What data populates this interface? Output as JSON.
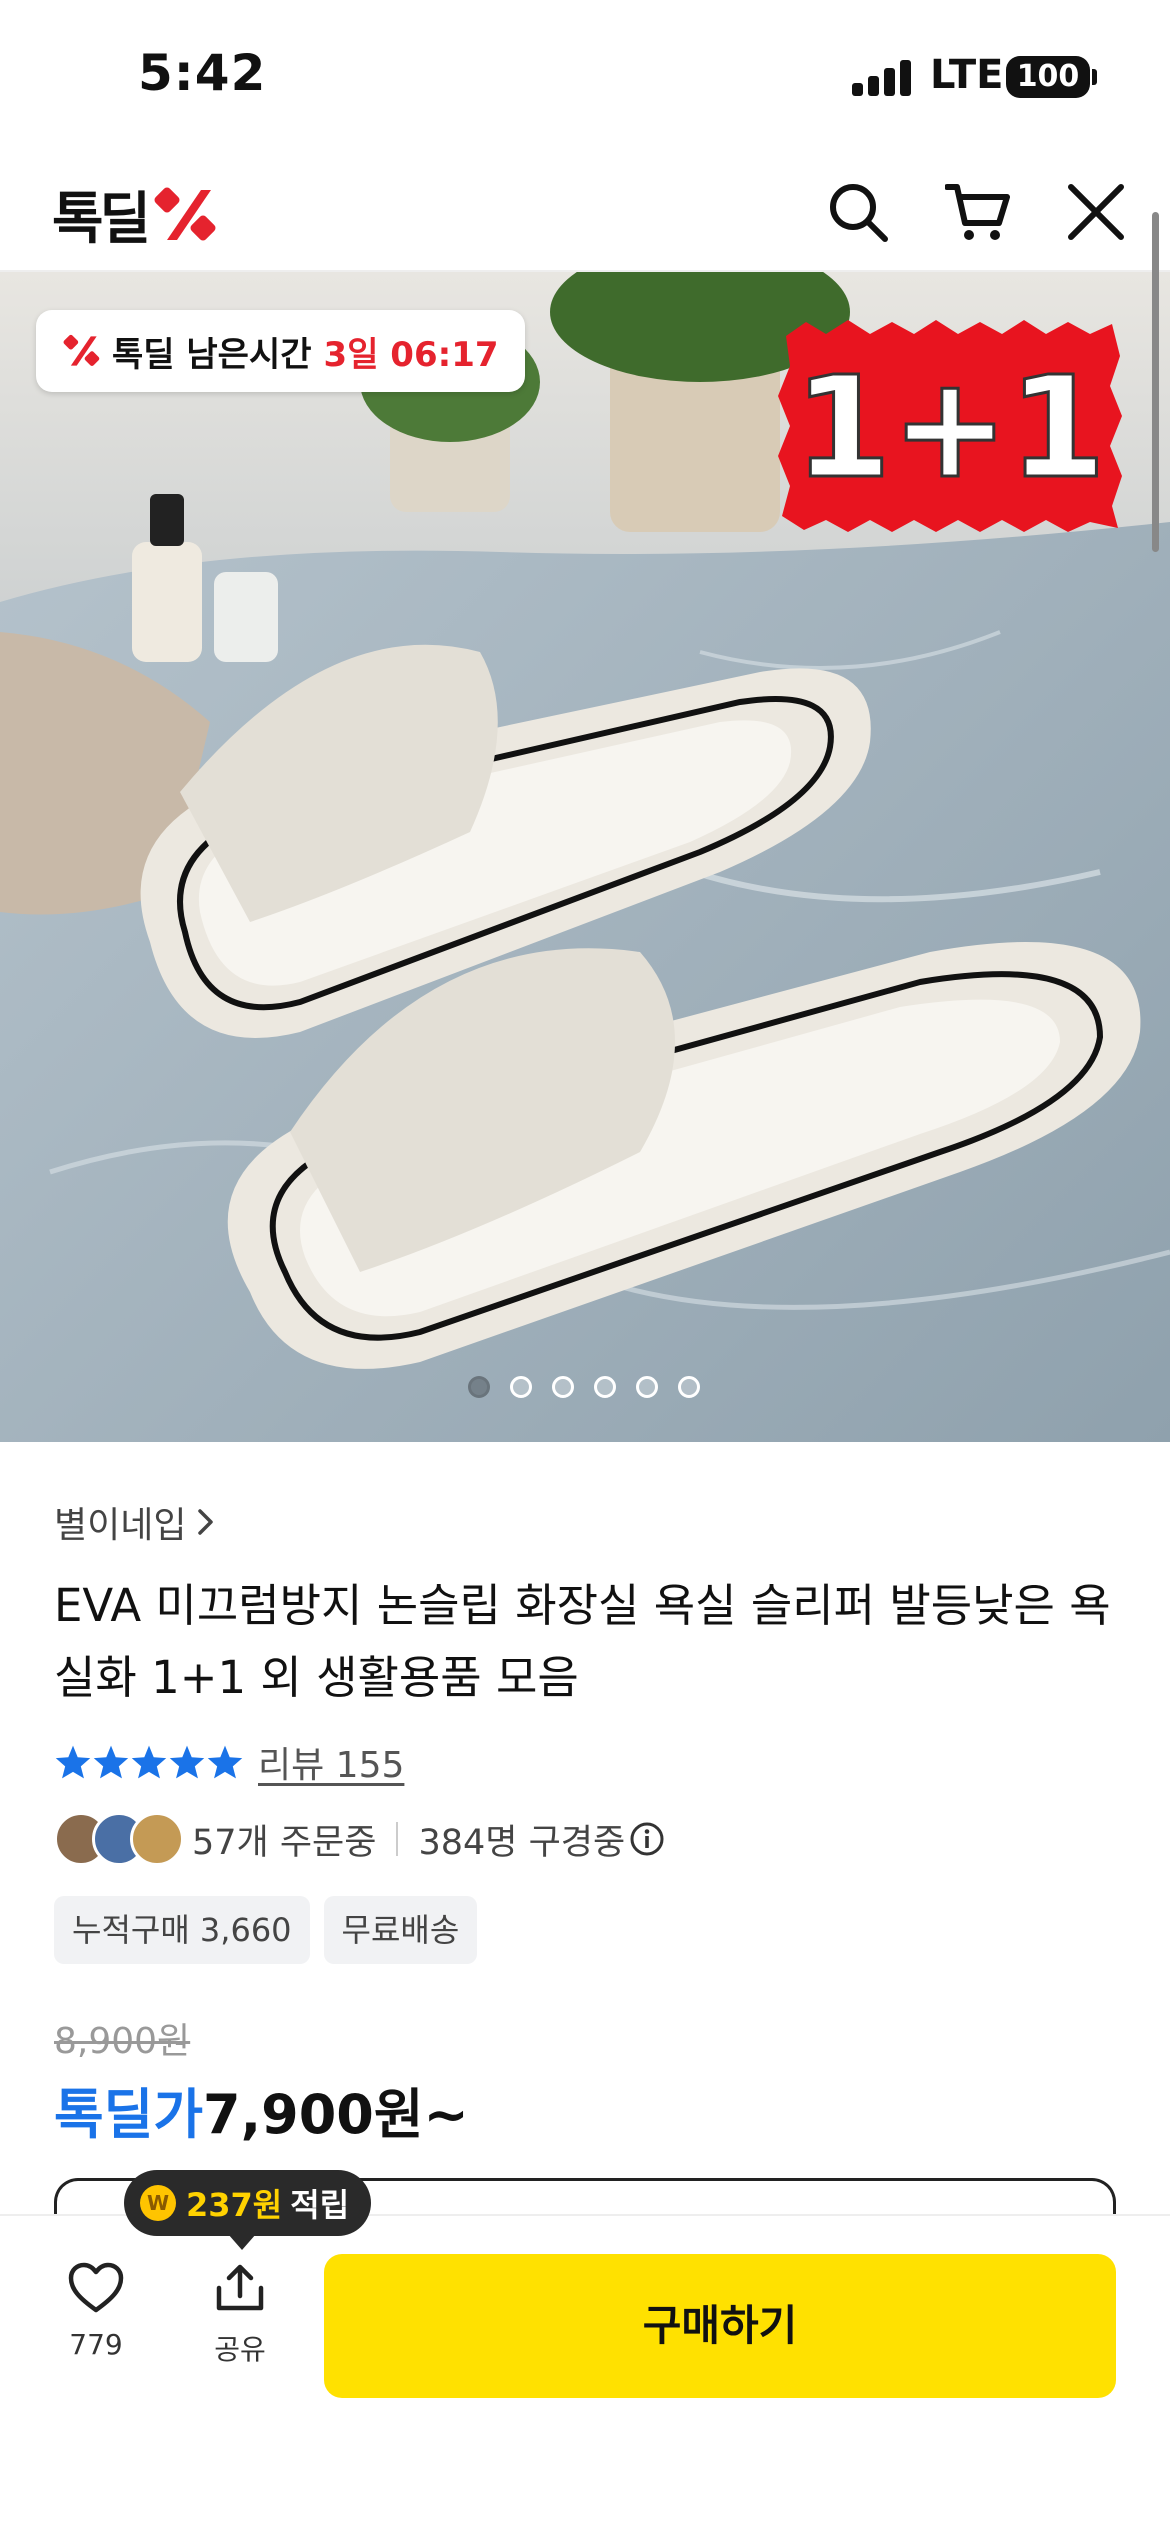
{
  "status_bar": {
    "time": "5:42",
    "network": "LTE",
    "battery": "100"
  },
  "header": {
    "logo_text": "톡딜",
    "icons": [
      "search-icon",
      "cart-icon",
      "close-icon"
    ]
  },
  "hero": {
    "timer_label": "톡딜 남은시간",
    "timer_value": "3일 06:17",
    "promo_text": "1+1",
    "image_count": 6,
    "active_image": 1
  },
  "product": {
    "seller": "별이네입",
    "title": "EVA 미끄럼방지 논슬립 화장실 욕실 슬리퍼 발등낮은 욕실화 1+1 외 생활용품 모음",
    "rating_stars": 5,
    "review_label": "리뷰 155",
    "orders": "57개 주문중",
    "viewers": "384명 구경중",
    "tags": [
      "누적구매 3,660",
      "무료배송"
    ],
    "original_price": "8,900원",
    "price_label": "톡딜가",
    "price": "7,900원~"
  },
  "points_bubble": {
    "amount": "237원",
    "label": "적립"
  },
  "bottom_bar": {
    "like_count": "779",
    "share_label": "공유",
    "buy_label": "구매하기"
  },
  "colors": {
    "accent_red": "#e5232e",
    "price_blue": "#1a73e8",
    "buy_yellow": "#ffe100",
    "star_blue": "#1a73e8"
  }
}
